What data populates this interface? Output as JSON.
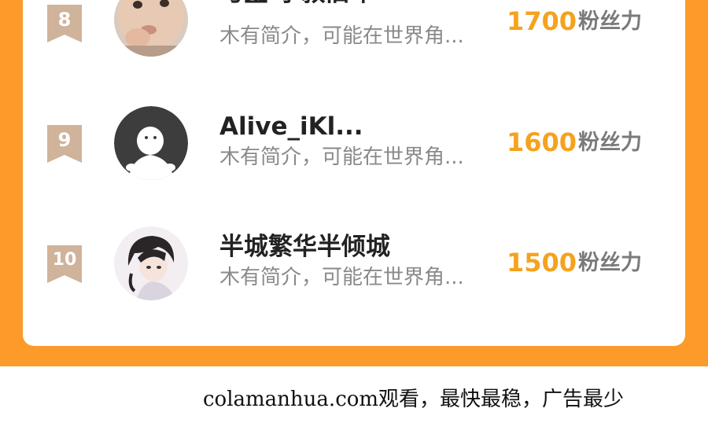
{
  "ranking": {
    "rows": [
      {
        "rank": "8",
        "name": "与἟ 尔叙旧年",
        "bio": "木有简介，可能在世界角...",
        "score": "1700",
        "unit": "粉丝力",
        "avatar": "baby-photo-avatar"
      },
      {
        "rank": "9",
        "name": "Alive_iKl...",
        "bio": "木有简介，可能在世界角...",
        "score": "1600",
        "unit": "粉丝力",
        "avatar": "default-user-avatar"
      },
      {
        "rank": "10",
        "name": "半城繁华半倾城",
        "bio": "木有简介，可能在世界角...",
        "score": "1500",
        "unit": "粉丝力",
        "avatar": "anime-character-avatar"
      }
    ]
  },
  "footer": {
    "watermark": "colamanhua.com观看，最快最稳，广告最少"
  },
  "colors": {
    "band": "#fc9b29",
    "score": "#f5a21e",
    "badge": "#cfb39a"
  }
}
